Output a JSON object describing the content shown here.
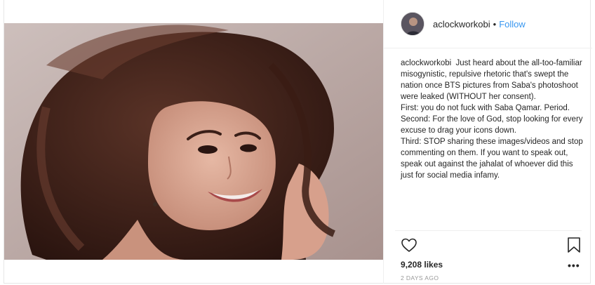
{
  "post": {
    "username": "aclockworkobi",
    "separator": "•",
    "follow_label": "Follow",
    "caption_user": "aclockworkobi",
    "caption_text": "Just heard about the all-too-familiar misogynistic, repulsive rhetoric that's swept the nation once BTS pictures from Saba's photoshoot were leaked (WITHOUT her consent).\nFirst: you do not fuck with Saba Qamar. Period.\nSecond: For the love of God, stop looking for every excuse to drag your icons down.\nThird: STOP sharing these images/videos and stop commenting on them. If you want to speak out, speak out against the jahalat of whoever did this just for social media infamy.",
    "likes": "9,208 likes",
    "time_ago": "2 DAYS AGO",
    "more_label": "•••"
  },
  "icons": {
    "heart": "heart-icon",
    "bookmark": "bookmark-icon",
    "more": "more-options-icon"
  },
  "colors": {
    "link_blue": "#3897f0",
    "text": "#262626",
    "muted": "#999999",
    "border": "#efefef"
  }
}
